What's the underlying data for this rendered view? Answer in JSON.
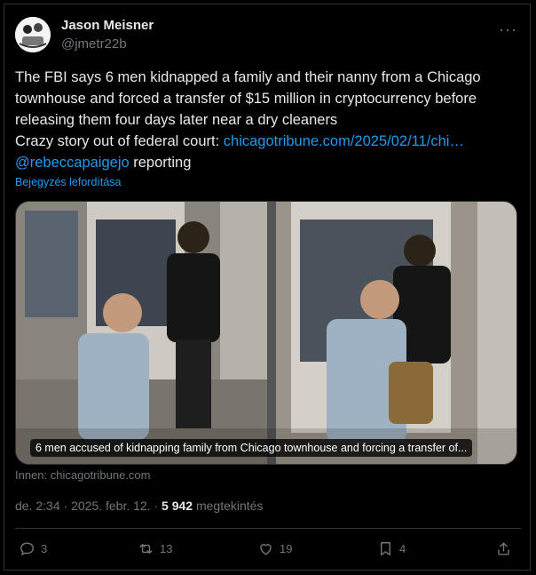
{
  "author": {
    "avatar_text": "Jason Meisner",
    "name": "Jason Meisner",
    "handle": "@jmetr22b"
  },
  "post": {
    "text_main": "The FBI says 6 men kidnapped a family and their nanny from a Chicago townhouse and forced a transfer of $15 million in cryptocurrency before releasing them four days later near a dry cleaners",
    "text_prefix": "Crazy story out of federal court: ",
    "link": "chicagotribune.com/2025/02/11/chi…",
    "mention": "@rebeccapaigejo",
    "mention_suffix": " reporting",
    "translate_label": "Bejegyzés lefordítása"
  },
  "media": {
    "caption": "6 men accused of kidnapping family from Chicago townhouse and forcing a transfer of...",
    "source": "Innen: chicagotribune.com"
  },
  "meta": {
    "time": "de. 2:34",
    "sep1": " · ",
    "date": "2025. febr. 12.",
    "sep2": " · ",
    "views": "5 942",
    "views_label": " megtekintés"
  },
  "actions": {
    "replies": "3",
    "reposts": "13",
    "likes": "19",
    "bookmarks": "4"
  },
  "colors": {
    "accent": "#1d9bf0",
    "muted": "#71767b",
    "text": "#e7e9ea",
    "border": "#2f3336"
  },
  "icons": [
    "more-icon",
    "reply-icon",
    "repost-icon",
    "like-icon",
    "bookmark-icon",
    "share-icon"
  ]
}
